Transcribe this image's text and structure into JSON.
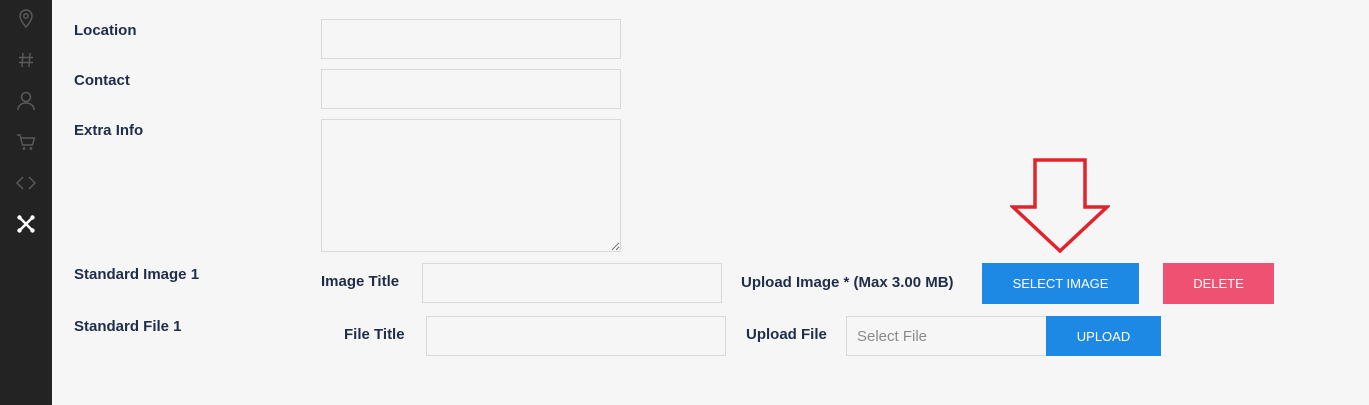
{
  "sidebar": {
    "items": [
      {
        "icon": "location-pin-icon"
      },
      {
        "icon": "hash-icon"
      },
      {
        "icon": "user-icon"
      },
      {
        "icon": "cart-icon"
      },
      {
        "icon": "code-icon"
      },
      {
        "icon": "joomla-icon",
        "active": true
      }
    ]
  },
  "form": {
    "location_label": "Location",
    "contact_label": "Contact",
    "extra_info_label": "Extra Info",
    "standard_image_label": "Standard Image 1",
    "image_title_label": "Image Title",
    "upload_image_label": "Upload Image * (Max 3.00 MB)",
    "select_image_button": "SELECT IMAGE",
    "delete_button": "DELETE",
    "standard_file_label": "Standard File 1",
    "file_title_label": "File Title",
    "upload_file_label": "Upload File",
    "select_file_placeholder": "Select File",
    "upload_button": "UPLOAD"
  },
  "colors": {
    "accent_blue": "#1e88e5",
    "delete_red": "#ef5172",
    "annotation_arrow": "#e0242c",
    "label_navy": "#1f2d4b"
  }
}
